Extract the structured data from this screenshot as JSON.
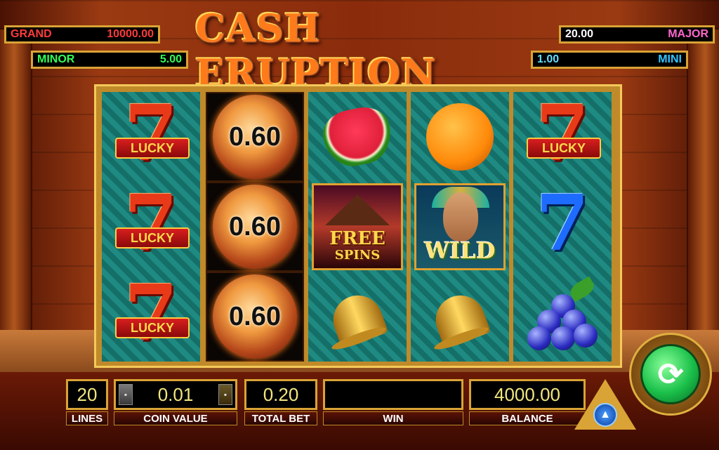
{
  "title": "CASH ERUPTION",
  "jackpots": {
    "grand": {
      "label": "GRAND",
      "value": "10000.00"
    },
    "minor": {
      "label": "MINOR",
      "value": "5.00"
    },
    "major": {
      "label": "MAJOR",
      "value": "20.00"
    },
    "mini": {
      "label": "MINI",
      "value": "1.00"
    }
  },
  "symbols": {
    "lucky": "LUCKY",
    "seven": "7",
    "fireball_value": "0.60",
    "free": "FREE",
    "spins": "SPINS",
    "wild": "WILD"
  },
  "reels": [
    [
      "lucky-seven",
      "lucky-seven",
      "lucky-seven"
    ],
    [
      "fireball",
      "fireball",
      "fireball"
    ],
    [
      "watermelon",
      "free-spins",
      "bell"
    ],
    [
      "orange",
      "wild",
      "bell"
    ],
    [
      "lucky-seven",
      "blue-seven",
      "grapes"
    ]
  ],
  "panel": {
    "lines_value": "20",
    "lines_label": "LINES",
    "coin_value": "0.01",
    "coin_label": "COIN VALUE",
    "total_bet_value": "0.20",
    "total_bet_label": "TOTAL BET",
    "win_value": "",
    "win_label": "WIN",
    "balance_value": "4000.00",
    "balance_label": "BALANCE"
  },
  "icons": {
    "spin": "refresh-icon",
    "menu": "pyramid-eye-icon",
    "coin_down": "coin-decrease-icon",
    "coin_up": "coin-increase-icon"
  },
  "colors": {
    "grand": "#ff3a3a",
    "minor": "#33ff55",
    "major": "#ff66cc",
    "mini": "#33c4ff",
    "frame_gold": "#d9a336",
    "reel_teal": "#1f8a82",
    "spin_green": "#1ac04a"
  }
}
